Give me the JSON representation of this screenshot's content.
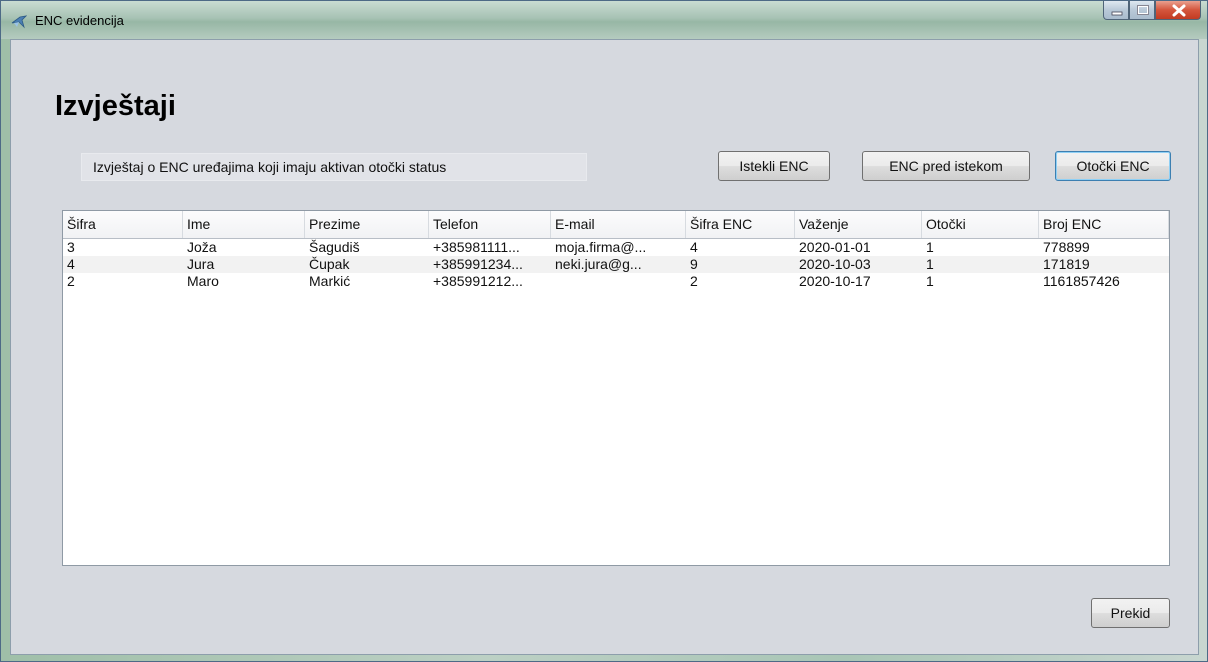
{
  "window": {
    "title": "ENC evidencija",
    "accent_color": "#9fbfa8",
    "close_color": "#c23b22"
  },
  "page": {
    "heading": "Izvještaji",
    "info_text": "Izvještaj o ENC uređajima koji imaju aktivan otočki status"
  },
  "buttons": {
    "expired": "Istekli ENC",
    "expiring": "ENC pred istekom",
    "island": "Otočki ENC",
    "cancel": "Prekid"
  },
  "table": {
    "columns": [
      "Šifra",
      "Ime",
      "Prezime",
      "Telefon",
      "E-mail",
      "Šifra ENC",
      "Važenje",
      "Otočki",
      "Broj ENC"
    ],
    "rows": [
      [
        "3",
        "Joža",
        "Šagudiš",
        "+385981111...",
        "moja.firma@...",
        "4",
        "2020-01-01",
        "1",
        "778899"
      ],
      [
        "4",
        "Jura",
        "Čupak",
        "+385991234...",
        "neki.jura@g...",
        "9",
        "2020-10-03",
        "1",
        "171819"
      ],
      [
        "2",
        "Maro",
        "Markić",
        "+385991212...",
        "",
        "2",
        "2020-10-17",
        "1",
        "1161857426"
      ]
    ]
  }
}
